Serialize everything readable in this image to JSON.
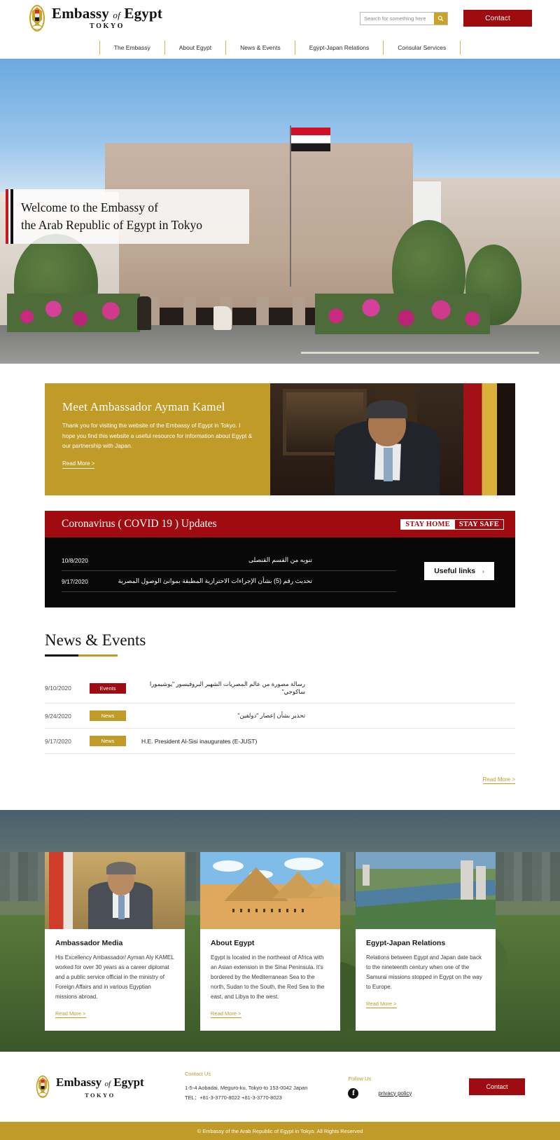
{
  "header": {
    "brand": {
      "title_main": "Embassy",
      "title_of": "of",
      "title_egypt": "Egypt",
      "subtitle": "TOKYO",
      "emblem_icon": "eagle-of-saladin-icon"
    },
    "search": {
      "placeholder": "Search for something here",
      "value": "",
      "icon": "search-icon"
    },
    "contact_label": "Contact"
  },
  "nav": {
    "items": [
      {
        "label": "The Embassy"
      },
      {
        "label": "About Egypt"
      },
      {
        "label": "News & Events"
      },
      {
        "label": "Egypt-Japan Relations"
      },
      {
        "label": "Consular Services"
      }
    ]
  },
  "hero": {
    "line1": "Welcome to the Embassy of",
    "line2": "the Arab Republic of Egypt in Tokyo"
  },
  "ambassador": {
    "title": "Meet Ambassador Ayman Kamel",
    "body": "Thank you for visiting the website of the Embassy of Egypt in Tokyo. I hope you find this website a useful resource for information about Egypt & our partnership with Japan.",
    "read_more": "Read More >"
  },
  "covid": {
    "title": "Coronavirus ( COVID 19 ) Updates",
    "stay_home": "STAY HOME",
    "stay_safe": "STAY SAFE",
    "useful_links": "Useful links",
    "chevron": "›",
    "items": [
      {
        "date": "10/8/2020",
        "text": "تنويه من القسم القنصلى"
      },
      {
        "date": "9/17/2020",
        "text": "تحديث رقم (5) بشأن الإجراءات الاحترازية المطبقة بموانئ الوصول المصرية"
      }
    ]
  },
  "news": {
    "title": "News & Events",
    "read_more": "Read More >",
    "items": [
      {
        "date": "9/10/2020",
        "badge": "Events",
        "badge_type": "events",
        "text": "رسالة مصورة من عالم المصريات الشهير البروفيسور \"يوشيمورا ساكوجي\"",
        "rtl": true
      },
      {
        "date": "9/24/2020",
        "badge": "News",
        "badge_type": "news",
        "text": "تحذير بشأن إعصار \"دولفين\"",
        "rtl": true
      },
      {
        "date": "9/17/2020",
        "badge": "News",
        "badge_type": "news",
        "text": "H.E. President Al-Sisi inaugurates (E-JUST)",
        "rtl": false
      }
    ]
  },
  "cards": [
    {
      "title": "Ambassador Media",
      "text": "His Excellency Ambassador/ Ayman Aly KAMEL worked for over 30 years as a career diplomat and a public service official in the ministry of Foreign Affairs and in various Egyptian missions abroad.",
      "read_more": "Read More >"
    },
    {
      "title": "About Egypt",
      "text": "Egypt is located in the northeast of Africa with an Asian extension in the Sinai Peninsula. It's bordered by the Mediterranean Sea to the north, Sudan to the South, the Red Sea to the east, and Libya to the west.",
      "read_more": "Read More >"
    },
    {
      "title": "Egypt-Japan Relations",
      "text": "Relations between Egypt and Japan date back to the nineteenth century when one of the Samurai missions stopped in Egypt on the way to Europe.",
      "read_more": "Read More >"
    }
  ],
  "footer": {
    "brand": {
      "title_main": "Embassy",
      "title_of": "of",
      "title_egypt": "Egypt",
      "subtitle": "TOKYO"
    },
    "contact_us_label": "Contact Us",
    "address": "1-5-4 Aobadai, Meguro-ku, Tokyo-to 153-0042 Japan",
    "tel": "TEL：+81-3-3770-8022   +81-3-3770-8023",
    "follow_us_label": "Follow Us",
    "facebook_icon": "facebook-icon",
    "privacy_policy": "privacy policy",
    "contact_label": "Contact",
    "copyright": "© Embassy of the Arab Republic of Egypt in Tokyo. All Rights Reserved"
  },
  "colors": {
    "gold": "#c09b28",
    "red": "#9e0b10",
    "dark_red": "#a00b10",
    "black": "#080808"
  }
}
